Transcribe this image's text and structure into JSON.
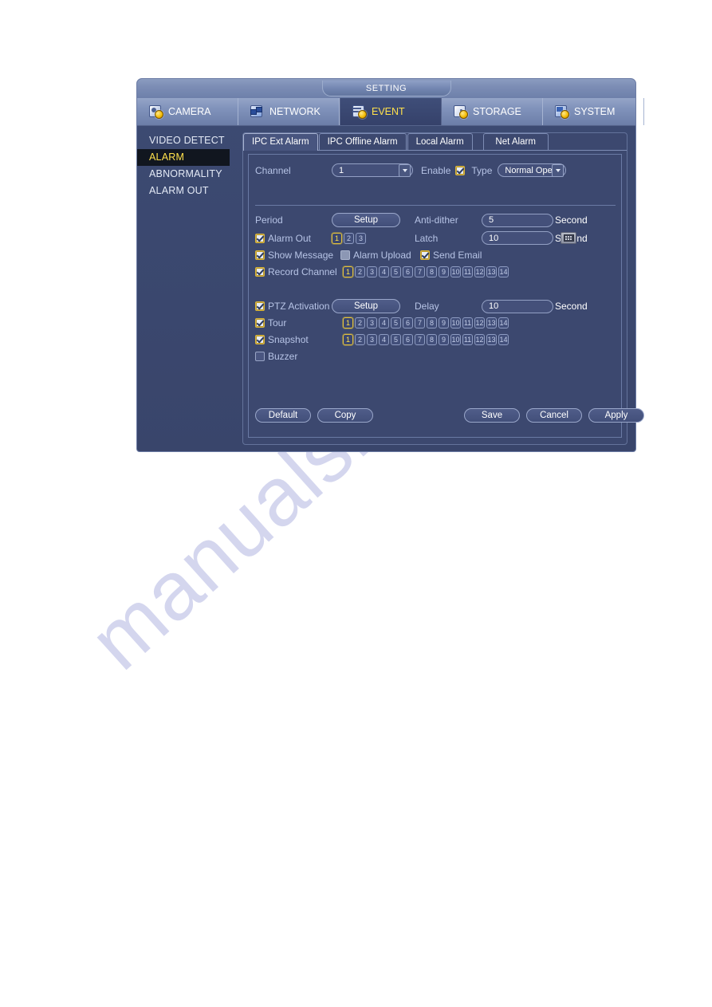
{
  "watermark": {
    "text": "manualshive.com"
  },
  "window": {
    "title": "SETTING",
    "menu": [
      {
        "label": "CAMERA",
        "icon": "camera-icon",
        "active": false
      },
      {
        "label": "NETWORK",
        "icon": "network-icon",
        "active": false
      },
      {
        "label": "EVENT",
        "icon": "event-icon",
        "active": true
      },
      {
        "label": "STORAGE",
        "icon": "storage-icon",
        "active": false
      },
      {
        "label": "SYSTEM",
        "icon": "system-icon",
        "active": false
      }
    ]
  },
  "sidebar": {
    "items": [
      {
        "label": "VIDEO DETECT",
        "active": false
      },
      {
        "label": "ALARM",
        "active": true
      },
      {
        "label": "ABNORMALITY",
        "active": false
      },
      {
        "label": "ALARM OUT",
        "active": false
      }
    ]
  },
  "tabs": [
    {
      "label": "IPC Ext Alarm",
      "active": true
    },
    {
      "label": "IPC Offline Alarm",
      "active": false
    },
    {
      "label": "Local Alarm",
      "active": false
    },
    {
      "label": "Net Alarm",
      "active": false
    }
  ],
  "form": {
    "channel_label": "Channel",
    "channel_value": "1",
    "enable_label": "Enable",
    "enable_checked": true,
    "type_label": "Type",
    "type_value": "Normal Open",
    "period_label": "Period",
    "period_button": "Setup",
    "antidither_label": "Anti-dither",
    "antidither_value": "5",
    "antidither_unit": "Second",
    "alarm_out_label": "Alarm Out",
    "alarm_out_checked": true,
    "alarm_out_channels": [
      "1",
      "2",
      "3"
    ],
    "alarm_out_selected": [
      "1"
    ],
    "latch_label": "Latch",
    "latch_value": "10",
    "latch_unit": "Second",
    "latch_keypad_icon": "keypad-icon",
    "show_message_label": "Show Message",
    "show_message_checked": true,
    "alarm_upload_label": "Alarm Upload",
    "alarm_upload_checked": false,
    "send_email_label": "Send Email",
    "send_email_checked": true,
    "record_channel_label": "Record Channel",
    "record_channel_checked": true,
    "record_channels": [
      "1",
      "2",
      "3",
      "4",
      "5",
      "6",
      "7",
      "8",
      "9",
      "10",
      "11",
      "12",
      "13",
      "14"
    ],
    "record_selected": [
      "1"
    ],
    "ptz_label": "PTZ Activation",
    "ptz_checked": true,
    "ptz_button": "Setup",
    "delay_label": "Delay",
    "delay_value": "10",
    "delay_unit": "Second",
    "tour_label": "Tour",
    "tour_checked": true,
    "tour_channels": [
      "1",
      "2",
      "3",
      "4",
      "5",
      "6",
      "7",
      "8",
      "9",
      "10",
      "11",
      "12",
      "13",
      "14"
    ],
    "tour_selected": [
      "1"
    ],
    "snapshot_label": "Snapshot",
    "snapshot_checked": true,
    "snapshot_channels": [
      "1",
      "2",
      "3",
      "4",
      "5",
      "6",
      "7",
      "8",
      "9",
      "10",
      "11",
      "12",
      "13",
      "14"
    ],
    "snapshot_selected": [
      "1"
    ],
    "buzzer_label": "Buzzer",
    "buzzer_checked": false
  },
  "buttons": {
    "default": "Default",
    "copy": "Copy",
    "save": "Save",
    "cancel": "Cancel",
    "apply": "Apply"
  },
  "colors": {
    "accent_yellow": "#ffe14c",
    "panel_blue": "#3c486f",
    "dialog_blue": "#39456b",
    "titlebar_blue": "#7c8db5"
  }
}
